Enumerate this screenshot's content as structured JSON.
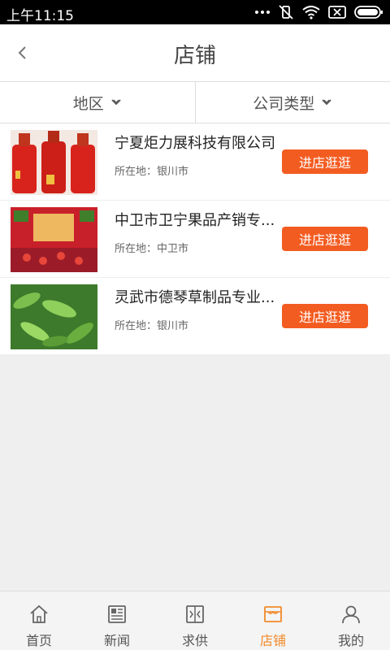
{
  "status_bar": {
    "time": "上午11:15"
  },
  "header": {
    "title": "店铺",
    "back_icon": "chevron-left-icon"
  },
  "filters": [
    {
      "label": "地区"
    },
    {
      "label": "公司类型"
    }
  ],
  "shops": [
    {
      "name": "宁夏炬力展科技有限公司",
      "location": "所在地：银川市",
      "button": "进店逛逛"
    },
    {
      "name": "中卫市卫宁果品产销专...",
      "location": "所在地：中卫市",
      "button": "进店逛逛"
    },
    {
      "name": "灵武市德琴草制品专业...",
      "location": "所在地：银川市",
      "button": "进店逛逛"
    }
  ],
  "tabbar": [
    {
      "label": "首页",
      "icon": "home-icon"
    },
    {
      "label": "新闻",
      "icon": "news-icon"
    },
    {
      "label": "求供",
      "icon": "supply-icon"
    },
    {
      "label": "店铺",
      "icon": "store-icon",
      "active": true
    },
    {
      "label": "我的",
      "icon": "user-icon"
    }
  ],
  "colors": {
    "accent": "#f35c21",
    "tab_active": "#f18a2a"
  }
}
